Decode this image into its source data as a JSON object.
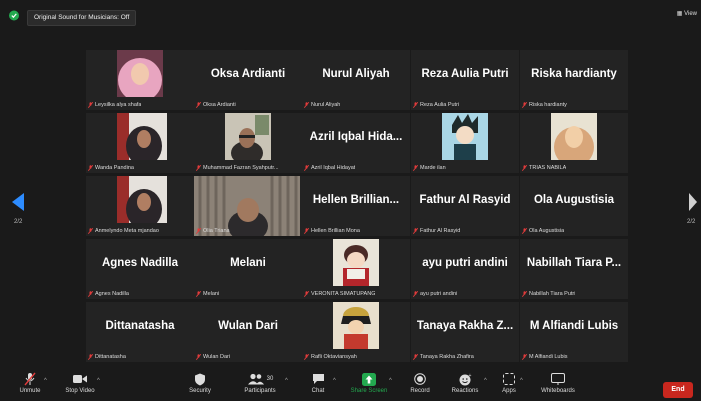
{
  "topbar": {
    "sound_label": "Original Sound for Musicians: Off",
    "view_label": "View"
  },
  "pagination": {
    "left": "2/2",
    "right": "2/2"
  },
  "participants": [
    {
      "big": "",
      "label": "Leysilka alya shafa",
      "photo": "hijab-pink"
    },
    {
      "big": "Oksa Ardianti",
      "label": "Oksa Ardianti"
    },
    {
      "big": "Nurul Aliyah",
      "label": "Nurul Aliyah"
    },
    {
      "big": "Reza Aulia Putri",
      "label": "Reza Aulia Putri"
    },
    {
      "big": "Riska hardianty",
      "label": "Riska hardianty"
    },
    {
      "big": "",
      "label": "Wanda Pandina",
      "photo": "hijab-dark"
    },
    {
      "big": "",
      "label": "Muhammad Fazran Syahputr...",
      "photo": "person-room"
    },
    {
      "big": "Azril Iqbal Hida...",
      "label": "Azril Iqbal Hidayat"
    },
    {
      "big": "",
      "label": "Marde ilan",
      "photo": "anime"
    },
    {
      "big": "",
      "label": "TRIAS NABILA",
      "photo": "hijab-light"
    },
    {
      "big": "",
      "label": "Anmelyndo Meta mjandao",
      "photo": "hijab-dark"
    },
    {
      "big": "",
      "label": "Olia Triana",
      "photo": "curtain"
    },
    {
      "big": "Hellen Brillian...",
      "label": "Hellen Brillian Mona"
    },
    {
      "big": "Fathur Al Rasyid",
      "label": "Fathur Al Rasyid"
    },
    {
      "big": "Ola Augustisia",
      "label": "Ola Augustisia"
    },
    {
      "big": "Agnes Nadilla",
      "label": "Agnes Nadilla"
    },
    {
      "big": "Melani",
      "label": "Melani"
    },
    {
      "big": "",
      "label": "VERONITA SIMATUPANG",
      "photo": "cartoon"
    },
    {
      "big": "ayu putri andini",
      "label": "ayu putri andini"
    },
    {
      "big": "Nabillah Tiara P...",
      "label": "Nabillah Tiara Putri"
    },
    {
      "big": "Dittanatasha",
      "label": "Dittanatasha"
    },
    {
      "big": "Wulan Dari",
      "label": "Wulan Dari"
    },
    {
      "big": "",
      "label": "Rafli Oktaviansyah",
      "photo": "anime2"
    },
    {
      "big": "Tanaya Rakha Z...",
      "label": "Tanaya Rakha Zhafira"
    },
    {
      "big": "M Alfiandi Lubis",
      "label": "M Alfiandi Lubis"
    }
  ],
  "toolbar": {
    "unmute": "Unmute",
    "stop_video": "Stop Video",
    "security": "Security",
    "participants": "Participants",
    "participants_count": "30",
    "chat": "Chat",
    "share_screen": "Share Screen",
    "record": "Record",
    "reactions": "Reactions",
    "apps": "Apps",
    "whiteboards": "Whiteboards",
    "end": "End"
  },
  "colors": {
    "background": "#1a1a1a",
    "tile": "#232323",
    "share_green": "#23a94f",
    "end_red": "#c8271e",
    "mute_red": "#e23b3b",
    "arrow_blue": "#2d8cff"
  }
}
